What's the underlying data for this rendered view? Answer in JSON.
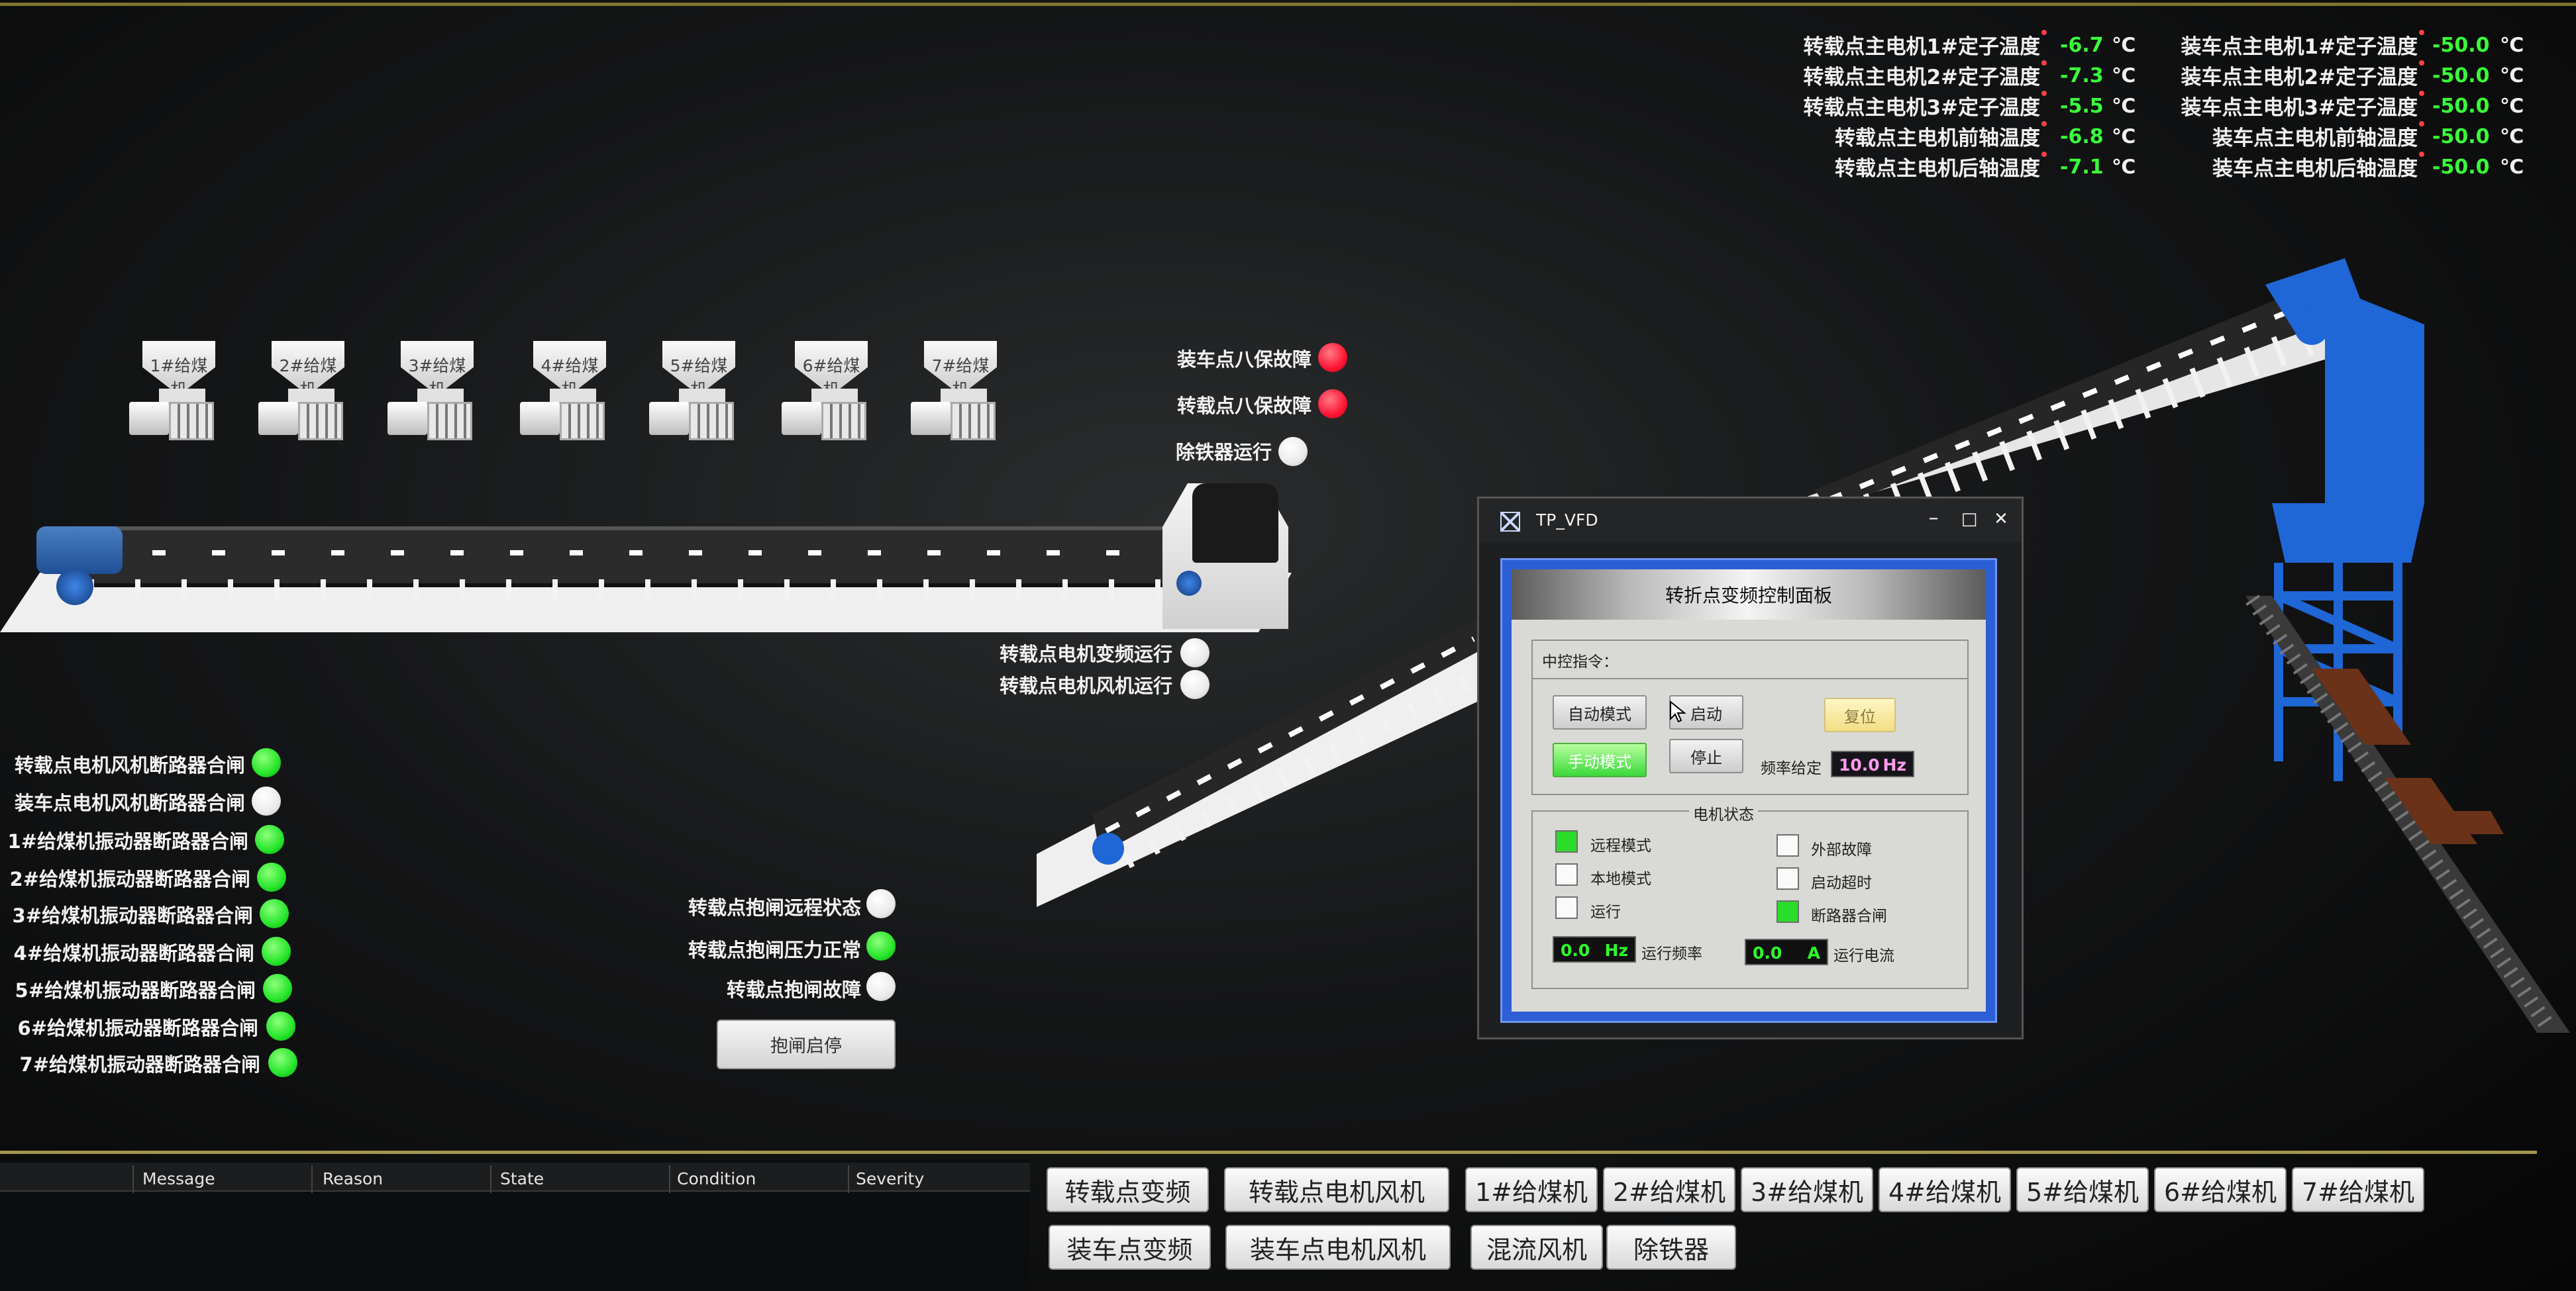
{
  "colors": {
    "lamp_red": "#ff1435",
    "lamp_green": "#25e52a",
    "lamp_white": "#eaeaea",
    "value_green": "#39ff39",
    "panel_blue": "#2c5ed6",
    "steel_blue": "#1f66d6"
  },
  "temps_transfer": [
    {
      "label": "转载点主电机1#定子温度",
      "value": "-6.7",
      "unit": "℃"
    },
    {
      "label": "转载点主电机2#定子温度",
      "value": "-7.3",
      "unit": "℃"
    },
    {
      "label": "转载点主电机3#定子温度",
      "value": "-5.5",
      "unit": "℃"
    },
    {
      "label": "转载点主电机前轴温度",
      "value": "-6.8",
      "unit": "℃"
    },
    {
      "label": "转载点主电机后轴温度",
      "value": "-7.1",
      "unit": "℃"
    }
  ],
  "temps_loading": [
    {
      "label": "装车点主电机1#定子温度",
      "value": "-50.0",
      "unit": "℃"
    },
    {
      "label": "装车点主电机2#定子温度",
      "value": "-50.0",
      "unit": "℃"
    },
    {
      "label": "装车点主电机3#定子温度",
      "value": "-50.0",
      "unit": "℃"
    },
    {
      "label": "装车点主电机前轴温度",
      "value": "-50.0",
      "unit": "℃"
    },
    {
      "label": "装车点主电机后轴温度",
      "value": "-50.0",
      "unit": "℃"
    }
  ],
  "feeders": [
    "1#给煤机",
    "2#给煤机",
    "3#给煤机",
    "4#给煤机",
    "5#给煤机",
    "6#给煤机",
    "7#给煤机"
  ],
  "top_status": [
    {
      "label": "装车点八保故障",
      "state": "red"
    },
    {
      "label": "转载点八保故障",
      "state": "red"
    },
    {
      "label": "除铁器运行",
      "state": "white"
    }
  ],
  "mid_status": [
    {
      "label": "转载点电机变频运行",
      "state": "white"
    },
    {
      "label": "转载点电机风机运行",
      "state": "white"
    }
  ],
  "breakers": [
    {
      "label": "转载点电机风机断路器合闸",
      "state": "green"
    },
    {
      "label": "装车点电机风机断路器合闸",
      "state": "white"
    },
    {
      "label": "1#给煤机振动器断路器合闸",
      "state": "green"
    },
    {
      "label": "2#给煤机振动器断路器合闸",
      "state": "green"
    },
    {
      "label": "3#给煤机振动器断路器合闸",
      "state": "green"
    },
    {
      "label": "4#给煤机振动器断路器合闸",
      "state": "green"
    },
    {
      "label": "5#给煤机振动器断路器合闸",
      "state": "green"
    },
    {
      "label": "6#给煤机振动器断路器合闸",
      "state": "green"
    },
    {
      "label": "7#给煤机振动器断路器合闸",
      "state": "green"
    }
  ],
  "brake_status": [
    {
      "label": "转载点抱闸远程状态",
      "state": "white"
    },
    {
      "label": "转载点抱闸压力正常",
      "state": "green"
    },
    {
      "label": "转载点抱闸故障",
      "state": "white"
    }
  ],
  "brake_button": "抱闸启停",
  "alarm_columns": [
    "Message",
    "Reason",
    "State",
    "Condition",
    "Severity"
  ],
  "nav_row1": [
    "转载点变频",
    "转载点电机风机",
    "1#给煤机",
    "2#给煤机",
    "3#给煤机",
    "4#给煤机",
    "5#给煤机",
    "6#给煤机",
    "7#给煤机"
  ],
  "nav_row2": [
    "装车点变频",
    "装车点电机风机",
    "混流风机",
    "除铁器"
  ],
  "vfd": {
    "window_title": "TP_VFD",
    "controls": {
      "minimize": "–",
      "maximize": "□",
      "close": "✕"
    },
    "panel_title": "转折点变频控制面板",
    "cmd_label": "中控指令：",
    "buttons": {
      "auto": "自动模式",
      "start": "启动",
      "reset": "复位",
      "manual": "手动模式",
      "stop": "停止"
    },
    "freq_set_label": "频率给定",
    "freq_set_value": "10.0",
    "freq_set_unit": "Hz",
    "motor_state_label": "电机状态",
    "checks": [
      {
        "label": "远程模式",
        "on": true
      },
      {
        "label": "本地模式",
        "on": false
      },
      {
        "label": "运行",
        "on": false
      },
      {
        "label": "外部故障",
        "on": false
      },
      {
        "label": "启动超时",
        "on": false
      },
      {
        "label": "断路器合闸",
        "on": true
      }
    ],
    "run_freq_value": "0.0",
    "run_freq_unit": "Hz",
    "run_freq_label": "运行频率",
    "run_current_value": "0.0",
    "run_current_unit": "A",
    "run_current_label": "运行电流"
  }
}
